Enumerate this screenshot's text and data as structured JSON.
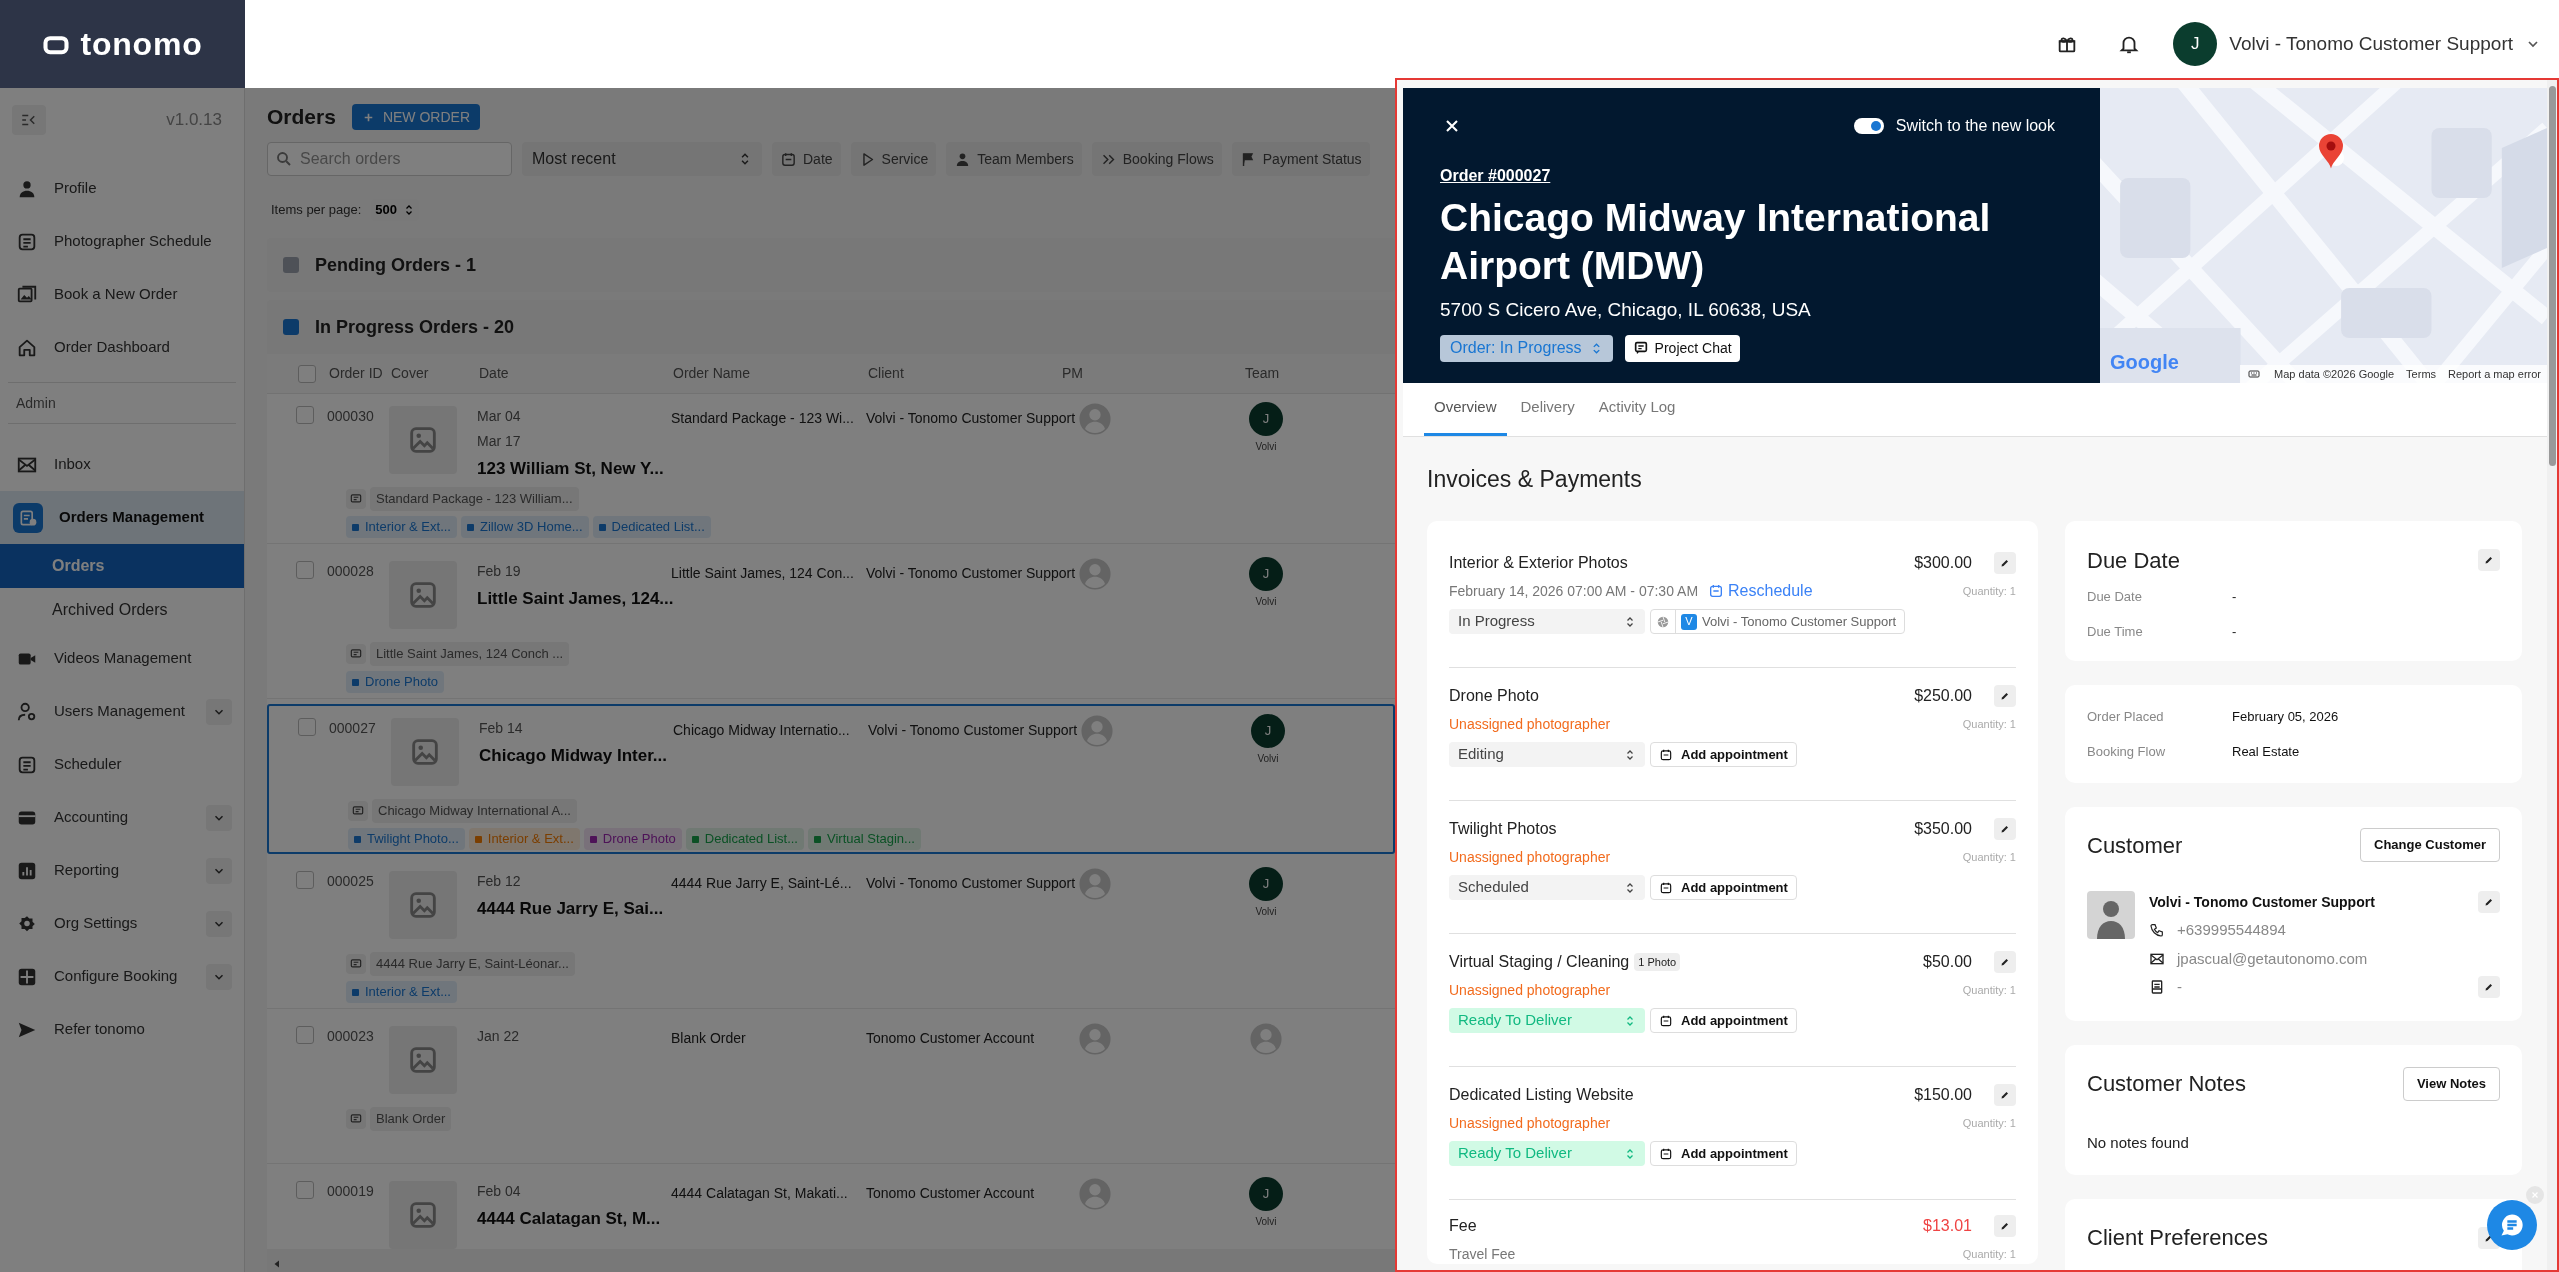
{
  "brand": {
    "logo_text": "tonomo"
  },
  "topbar": {
    "user": {
      "initial": "J",
      "name": "Volvi - Tonomo Customer Support"
    }
  },
  "sidebar": {
    "version": "v1.0.13",
    "sections": [
      {
        "items": [
          {
            "label": "Profile",
            "selected": false
          },
          {
            "label": "Photographer Schedule",
            "selected": false
          },
          {
            "label": "Book a New Order",
            "selected": false
          },
          {
            "label": "Order Dashboard",
            "selected": false
          }
        ]
      },
      {
        "label": "Admin",
        "items": [
          {
            "label": "Inbox",
            "selected": false
          },
          {
            "label": "Orders Management",
            "selected": true,
            "expanded": true,
            "children": [
              {
                "label": "Orders",
                "selected": true
              },
              {
                "label": "Archived Orders",
                "selected": false
              }
            ]
          },
          {
            "label": "Videos Management",
            "selected": false
          },
          {
            "label": "Users Management",
            "selected": false,
            "expanded": false
          },
          {
            "label": "Scheduler",
            "selected": false
          },
          {
            "label": "Accounting",
            "selected": false,
            "expanded": false
          },
          {
            "label": "Reporting",
            "selected": false,
            "expanded": false
          },
          {
            "label": "Org Settings",
            "selected": false,
            "expanded": false
          },
          {
            "label": "Configure Booking",
            "selected": false,
            "expanded": false
          },
          {
            "label": "Refer tonomo",
            "selected": false
          }
        ]
      }
    ]
  },
  "orders": {
    "title": "Orders",
    "new_button": "NEW ORDER",
    "search": {
      "placeholder": "Search orders"
    },
    "sort": "Most recent",
    "filters": [
      "Date",
      "Service",
      "Team Members",
      "Booking Flows",
      "Payment Status"
    ],
    "items_per_page": {
      "label": "Items per page:",
      "value": "500"
    },
    "groups": [
      {
        "title": "Pending Orders - 1",
        "color": "#4e5157"
      },
      {
        "title": "In Progress Orders - 20",
        "color": "#0d3b69",
        "all_selected": false,
        "columns": [
          "Order ID",
          "Cover",
          "Date",
          "Order Name",
          "Client",
          "PM",
          "Team"
        ],
        "rows": [
          {
            "id": "000030",
            "dates": [
              "Mar 04",
              "Mar 17"
            ],
            "address": "123 William St, New Y...",
            "order_name": "Standard Package - 123 Wi...",
            "client": "Volvi - Tonomo Customer Support",
            "team": {
              "initial": "J",
              "name": "Volvi"
            },
            "note": "Standard Package - 123 William...",
            "selected": false,
            "tags": [
              {
                "label": "Interior & Ext...",
                "color": "#0d3b69"
              },
              {
                "label": "Zillow 3D Home...",
                "color": "#0d3b69"
              },
              {
                "label": "Dedicated List...",
                "color": "#0d3b69"
              }
            ]
          },
          {
            "id": "000028",
            "dates": [
              "Feb 19"
            ],
            "address": "Little Saint James, 124...",
            "order_name": "Little Saint James, 124 Con...",
            "client": "Volvi - Tonomo Customer Support",
            "team": {
              "initial": "J",
              "name": "Volvi"
            },
            "note": "Little Saint James, 124 Conch ...",
            "selected": false,
            "tags": [
              {
                "label": "Drone Photo",
                "color": "#0d3b69"
              }
            ]
          },
          {
            "id": "000027",
            "dates": [
              "Feb 14"
            ],
            "address": "Chicago Midway Inter...",
            "order_name": "Chicago Midway Internatio...",
            "client": "Volvi - Tonomo Customer Support",
            "team": {
              "initial": "J",
              "name": "Volvi"
            },
            "note": "Chicago Midway International A...",
            "selected": true,
            "tags": [
              {
                "label": "Twilight Photo...",
                "color": "#0d3b69"
              },
              {
                "label": "Interior & Ext...",
                "color": "#7b3e00"
              },
              {
                "label": "Drone Photo",
                "color": "#4e1358"
              },
              {
                "label": "Dedicated List...",
                "color": "#0b5125"
              },
              {
                "label": "Virtual Stagin...",
                "color": "#0b5125"
              }
            ]
          },
          {
            "id": "000025",
            "dates": [
              "Feb 12"
            ],
            "address": "4444 Rue Jarry E, Sai...",
            "order_name": "4444 Rue Jarry E, Saint-Lé...",
            "client": "Volvi - Tonomo Customer Support",
            "team": {
              "initial": "J",
              "name": "Volvi"
            },
            "note": "4444 Rue Jarry E, Saint-Léonar...",
            "selected": false,
            "tags": [
              {
                "label": "Interior & Ext...",
                "color": "#0d3b69"
              }
            ]
          },
          {
            "id": "000023",
            "dates": [
              "Jan 22"
            ],
            "order_name": "Blank Order",
            "client": "Tonomo Customer Account",
            "note": "Blank Order",
            "selected": false
          },
          {
            "id": "000019",
            "dates": [
              "Feb 04"
            ],
            "address": "4444 Calatagan St, M...",
            "order_name": "4444 Calatagan St, Makati...",
            "client": "Tonomo Customer Account",
            "team": {
              "initial": "J",
              "name": "Volvi"
            },
            "selected": false
          }
        ]
      }
    ]
  },
  "order_panel": {
    "new_look": {
      "label": "Switch to the new look",
      "on": true
    },
    "order_link": "Order #000027",
    "title": "Chicago Midway International Airport (MDW)",
    "address": "5700 S Cicero Ave, Chicago, IL 60638, USA",
    "status": "Order: In Progress",
    "chat_button": "Project Chat",
    "map": {
      "kind": "picture",
      "logo": "Google",
      "attribution": "Map data ©2026 Google",
      "terms": "Terms",
      "report": "Report a map error"
    },
    "tabs": [
      {
        "label": "Overview",
        "selected": true
      },
      {
        "label": "Delivery",
        "selected": false
      },
      {
        "label": "Activity Log",
        "selected": false
      }
    ],
    "invoices": {
      "title": "Invoices & Payments",
      "services": [
        {
          "kind": "service",
          "name": "Interior & Exterior Photos",
          "price": "$300.00",
          "quantity": "Quantity: 1",
          "schedule": "February 14, 2026 07:00 AM - 07:30 AM",
          "reschedule": "Reschedule",
          "status": {
            "label": "In Progress",
            "kind": "neutral"
          },
          "photographer": {
            "initial": "V",
            "name": "Volvi - Tonomo Customer Support"
          }
        },
        {
          "kind": "service",
          "name": "Drone Photo",
          "price": "$250.00",
          "quantity": "Quantity: 1",
          "assignee": "Unassigned photographer",
          "status": {
            "label": "Editing",
            "kind": "neutral"
          },
          "action": "Add appointment"
        },
        {
          "kind": "service",
          "name": "Twilight Photos",
          "price": "$350.00",
          "quantity": "Quantity: 1",
          "assignee": "Unassigned photographer",
          "status": {
            "label": "Scheduled",
            "kind": "neutral"
          },
          "action": "Add appointment"
        },
        {
          "kind": "service",
          "name": "Virtual Staging / Cleaning",
          "badge": "1 Photo",
          "price": "$50.00",
          "quantity": "Quantity: 1",
          "assignee": "Unassigned photographer",
          "status": {
            "label": "Ready To Deliver",
            "kind": "ready"
          },
          "action": "Add appointment"
        },
        {
          "kind": "service",
          "name": "Dedicated Listing Website",
          "price": "$150.00",
          "quantity": "Quantity: 1",
          "assignee": "Unassigned photographer",
          "status": {
            "label": "Ready To Deliver",
            "kind": "ready"
          },
          "action": "Add appointment"
        },
        {
          "kind": "fee",
          "name": "Fee",
          "price": "$13.01",
          "subtitle": "Travel Fee",
          "quantity": "Quantity: 1"
        }
      ]
    },
    "due_date": {
      "title": "Due Date",
      "fields": [
        {
          "label": "Due Date",
          "value": "-"
        },
        {
          "label": "Due Time",
          "value": "-"
        }
      ]
    },
    "order_info": [
      {
        "label": "Order Placed",
        "value": "February 05, 2026"
      },
      {
        "label": "Booking Flow",
        "value": "Real Estate"
      }
    ],
    "customer": {
      "title": "Customer",
      "change_button": "Change Customer",
      "name": "Volvi - Tonomo Customer Support",
      "phone": "+639995544894",
      "email": "jpascual@getautonomo.com",
      "extra": "-"
    },
    "customer_notes": {
      "title": "Customer Notes",
      "button": "View Notes",
      "empty": "No notes found"
    },
    "client_preferences": {
      "title": "Client Preferences"
    }
  }
}
